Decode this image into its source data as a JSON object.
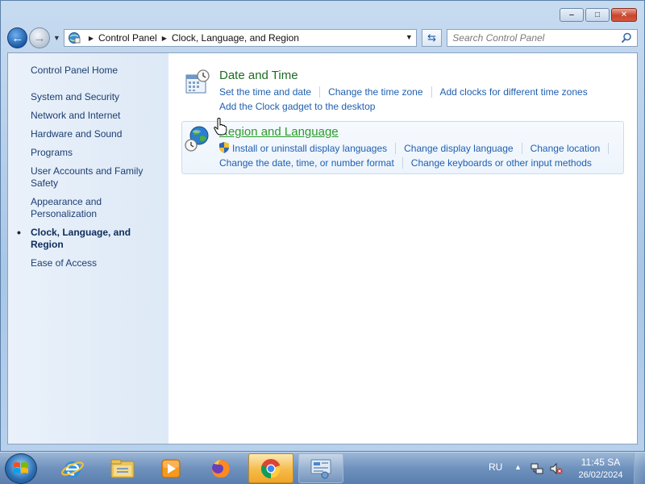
{
  "window": {
    "caption": {
      "minimize": "‒",
      "maximize": "□",
      "close": "✕"
    }
  },
  "nav": {
    "back_icon": "arrow-left-icon",
    "forward_icon": "arrow-right-icon",
    "breadcrumb": [
      "Control Panel",
      "Clock, Language, and Region"
    ],
    "search_placeholder": "Search Control Panel"
  },
  "sidebar": {
    "items": [
      {
        "label": "Control Panel Home"
      },
      {
        "label": "System and Security"
      },
      {
        "label": "Network and Internet"
      },
      {
        "label": "Hardware and Sound"
      },
      {
        "label": "Programs"
      },
      {
        "label": "User Accounts and Family Safety"
      },
      {
        "label": "Appearance and Personalization"
      },
      {
        "label": "Clock, Language, and Region"
      },
      {
        "label": "Ease of Access"
      }
    ]
  },
  "categories": [
    {
      "title": "Date and Time",
      "icon": "calendar-clock-icon",
      "tasks": [
        "Set the time and date",
        "Change the time zone",
        "Add clocks for different time zones",
        "Add the Clock gadget to the desktop"
      ]
    },
    {
      "title": "Region and Language",
      "icon": "globe-clock-icon",
      "tasks": [
        "Install or uninstall display languages",
        "Change display language",
        "Change location",
        "Change the date, time, or number format",
        "Change keyboards or other input methods"
      ]
    }
  ],
  "taskbar": {
    "apps": [
      "internet-explorer-icon",
      "file-explorer-icon",
      "media-player-icon",
      "firefox-icon",
      "chrome-icon",
      "control-panel-icon"
    ],
    "tray": {
      "language": "RU",
      "time": "11:45 SA",
      "date": "26/02/2024"
    }
  },
  "colors": {
    "link": "#1f5fb0",
    "category_title": "#1e6b24",
    "category_title_hover": "#2b9b2b",
    "sidebar_text": "#1c3e72"
  }
}
